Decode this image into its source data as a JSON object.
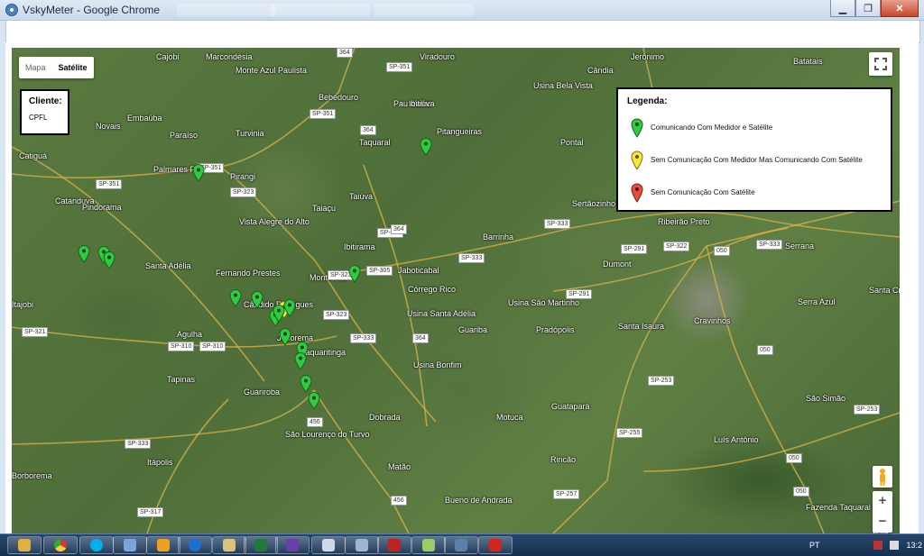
{
  "window": {
    "title": "VskyMeter - Google Chrome"
  },
  "window_controls": {
    "minimize": "▁",
    "maximize": "❐",
    "close": "✕"
  },
  "map_type": {
    "mapa": "Mapa",
    "satelite": "Satélite"
  },
  "cliente": {
    "label": "Cliente:",
    "value": "CPFL"
  },
  "legend": {
    "title": "Legenda:",
    "items": [
      {
        "label": "Comunicando Com Medidor e Satélite",
        "color": "#2ecc40"
      },
      {
        "label": "Sem Comunicação Com Medidor Mas Comunicando Com Satélite",
        "color": "#f5e642"
      },
      {
        "label": "Sem Comunicação Com Satélite",
        "color": "#e74c3c"
      }
    ]
  },
  "zoom": {
    "plus": "+",
    "minus": "−"
  },
  "places": [
    "Cajobi",
    "Marcondésia",
    "Monte Azul Paulista",
    "Viradouro",
    "Bebedouro",
    "Pau d'alho",
    "Ibitiúva",
    "Pitangueiras",
    "Cândia",
    "Usina Bela Vista",
    "Batatais",
    "Jerônimo",
    "Novais",
    "Embaúba",
    "Paraíso",
    "Turvinia",
    "Taquaral",
    "Pontal",
    "Catiguá",
    "Palmares Paulista",
    "Pirangi",
    "Taiúva",
    "Catanduva",
    "Taiaçu",
    "Vista Alegre do Alto",
    "Sertãozinho",
    "Ribeirão Preto",
    "Pindorama",
    "Barrinha",
    "Ibitirama",
    "Serrana",
    "Santa Adélia",
    "Fernando Prestes",
    "Monte Alto",
    "Jaboticabal",
    "Dumont",
    "Córrego Rico",
    "Serra Azul",
    "Santa Cruz da Esperança",
    "Itajobi",
    "Cândido Rodrigues",
    "Usina São Martinho",
    "Usina Santa Adélia",
    "Cravinhos",
    "Agulha",
    "Jaborema",
    "Guariba",
    "Pradópolis",
    "Santa Isaura",
    "Taquaritinga",
    "Usina Bonfim",
    "Tapinas",
    "Guariroba",
    "São Simão",
    "Guatapará",
    "Dobrada",
    "Motuca",
    "São Lourenço do Turvo",
    "Luís Antônio",
    "Borborema",
    "Itápolis",
    "Rincão",
    "Matão",
    "Bueno de Andrada",
    "Fazenda Taquaral"
  ],
  "road_labels": [
    "SP-351",
    "SP-351",
    "SP-351",
    "SP-351",
    "SP-323",
    "SP-323",
    "SP-323",
    "SP-305",
    "SP-333",
    "SP-333",
    "SP-333",
    "SP-333",
    "SP-333",
    "SP-291",
    "SP-291",
    "SP-322",
    "SP-333",
    "SP-310",
    "SP-310",
    "SP-321",
    "SP-253",
    "SP-253",
    "SP-255",
    "SP-257",
    "SP-317",
    "364",
    "364",
    "364",
    "364",
    "456",
    "456",
    "050",
    "050",
    "050",
    "050",
    "050"
  ],
  "markers": [
    {
      "status": "green",
      "lat_label": "Ibitiúva"
    },
    {
      "status": "green"
    },
    {
      "status": "green"
    },
    {
      "status": "green"
    },
    {
      "status": "green"
    },
    {
      "status": "green"
    },
    {
      "status": "green"
    },
    {
      "status": "green"
    },
    {
      "status": "yellow"
    },
    {
      "status": "green"
    },
    {
      "status": "green"
    },
    {
      "status": "green"
    },
    {
      "status": "green"
    },
    {
      "status": "green"
    },
    {
      "status": "green"
    },
    {
      "status": "green"
    },
    {
      "status": "green"
    }
  ],
  "taskbar": {
    "apps": [
      "explorer",
      "chrome",
      "skype",
      "remote-desktop",
      "outlook",
      "teamviewer",
      "folder",
      "excel",
      "visual-studio",
      "notepad",
      "window",
      "filezilla",
      "notepad-plus",
      "terminal",
      "acrobat"
    ],
    "tray": {
      "lang": "PT",
      "time": "13:2"
    }
  }
}
